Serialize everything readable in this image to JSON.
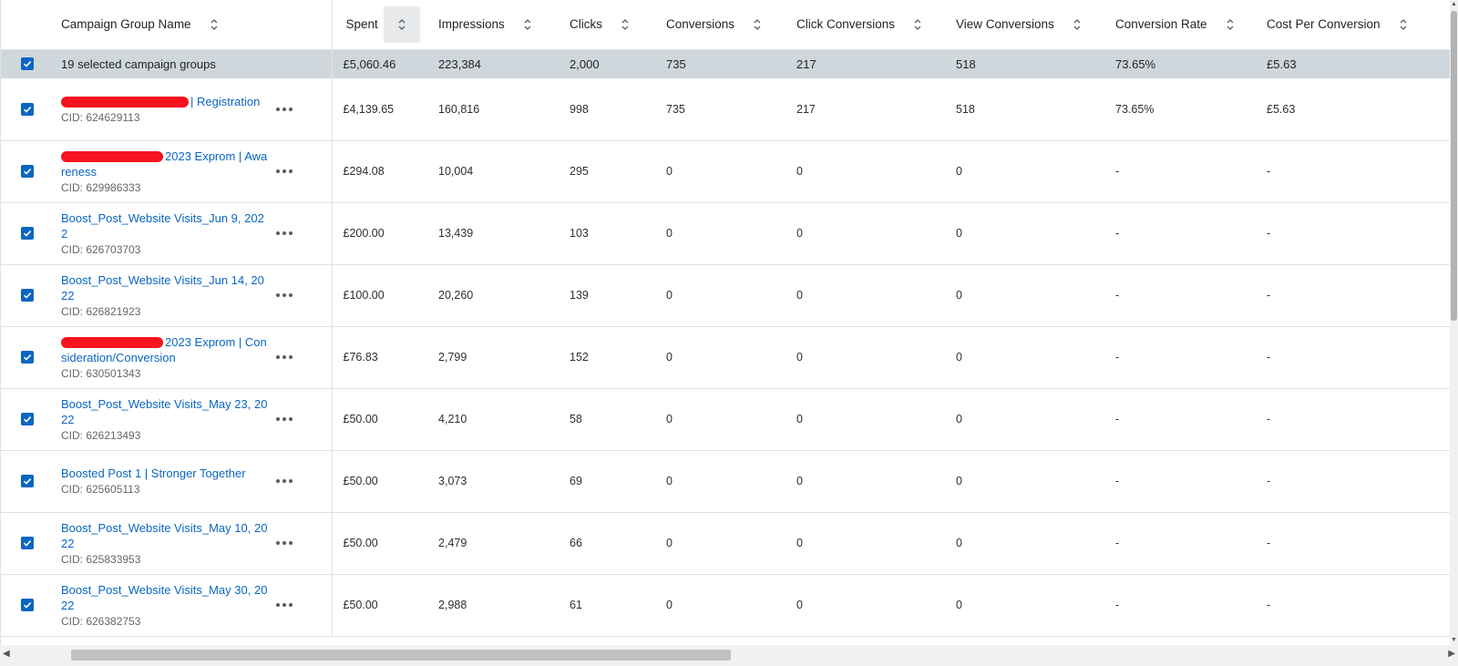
{
  "header": {
    "name": "Campaign Group Name",
    "spent": "Spent",
    "impressions": "Impressions",
    "clicks": "Clicks",
    "conversions": "Conversions",
    "click_conversions": "Click Conversions",
    "view_conversions": "View Conversions",
    "conversion_rate": "Conversion Rate",
    "cost_per_conversion": "Cost Per Conversion"
  },
  "summary": {
    "label": "19 selected campaign groups",
    "spent": "£5,060.46",
    "impressions": "223,384",
    "clicks": "2,000",
    "conversions": "735",
    "click_conversions": "217",
    "view_conversions": "518",
    "conversion_rate": "73.65%",
    "cost_per_conversion": "£5.63"
  },
  "rows": [
    {
      "name": "| Registration",
      "cid": "CID: 624629113",
      "spent": "£4,139.65",
      "impressions": "160,816",
      "clicks": "998",
      "conversions": "735",
      "click_conversions": "217",
      "view_conversions": "518",
      "conversion_rate": "73.65%",
      "cost_per_conversion": "£5.63"
    },
    {
      "name": "2023 Exprom | Awareness",
      "cid": "CID: 629986333",
      "spent": "£294.08",
      "impressions": "10,004",
      "clicks": "295",
      "conversions": "0",
      "click_conversions": "0",
      "view_conversions": "0",
      "conversion_rate": "-",
      "cost_per_conversion": "-"
    },
    {
      "name": "Boost_Post_Website Visits_Jun 9, 2022",
      "cid": "CID: 626703703",
      "spent": "£200.00",
      "impressions": "13,439",
      "clicks": "103",
      "conversions": "0",
      "click_conversions": "0",
      "view_conversions": "0",
      "conversion_rate": "-",
      "cost_per_conversion": "-"
    },
    {
      "name": "Boost_Post_Website Visits_Jun 14, 2022",
      "cid": "CID: 626821923",
      "spent": "£100.00",
      "impressions": "20,260",
      "clicks": "139",
      "conversions": "0",
      "click_conversions": "0",
      "view_conversions": "0",
      "conversion_rate": "-",
      "cost_per_conversion": "-"
    },
    {
      "name": "2023 Exprom | Consideration/Conversion",
      "cid": "CID: 630501343",
      "spent": "£76.83",
      "impressions": "2,799",
      "clicks": "152",
      "conversions": "0",
      "click_conversions": "0",
      "view_conversions": "0",
      "conversion_rate": "-",
      "cost_per_conversion": "-"
    },
    {
      "name": "Boost_Post_Website Visits_May 23, 2022",
      "cid": "CID: 626213493",
      "spent": "£50.00",
      "impressions": "4,210",
      "clicks": "58",
      "conversions": "0",
      "click_conversions": "0",
      "view_conversions": "0",
      "conversion_rate": "-",
      "cost_per_conversion": "-"
    },
    {
      "name": "Boosted Post 1 | Stronger Together",
      "cid": "CID: 625605113",
      "spent": "£50.00",
      "impressions": "3,073",
      "clicks": "69",
      "conversions": "0",
      "click_conversions": "0",
      "view_conversions": "0",
      "conversion_rate": "-",
      "cost_per_conversion": "-"
    },
    {
      "name": "Boost_Post_Website Visits_May 10, 2022",
      "cid": "CID: 625833953",
      "spent": "£50.00",
      "impressions": "2,479",
      "clicks": "66",
      "conversions": "0",
      "click_conversions": "0",
      "view_conversions": "0",
      "conversion_rate": "-",
      "cost_per_conversion": "-"
    },
    {
      "name": "Boost_Post_Website Visits_May 30, 2022",
      "cid": "CID: 626382753",
      "spent": "£50.00",
      "impressions": "2,988",
      "clicks": "61",
      "conversions": "0",
      "click_conversions": "0",
      "view_conversions": "0",
      "conversion_rate": "-",
      "cost_per_conversion": "-"
    }
  ],
  "colors": {
    "link": "#0a66c2",
    "summary_bg": "#cfd7dc",
    "checkbox": "#0a66c2",
    "redaction": "#f4131e"
  },
  "icons": {
    "sort": "sort-updown-icon",
    "checkbox": "checkmark-icon",
    "more": "ellipsis-icon"
  }
}
